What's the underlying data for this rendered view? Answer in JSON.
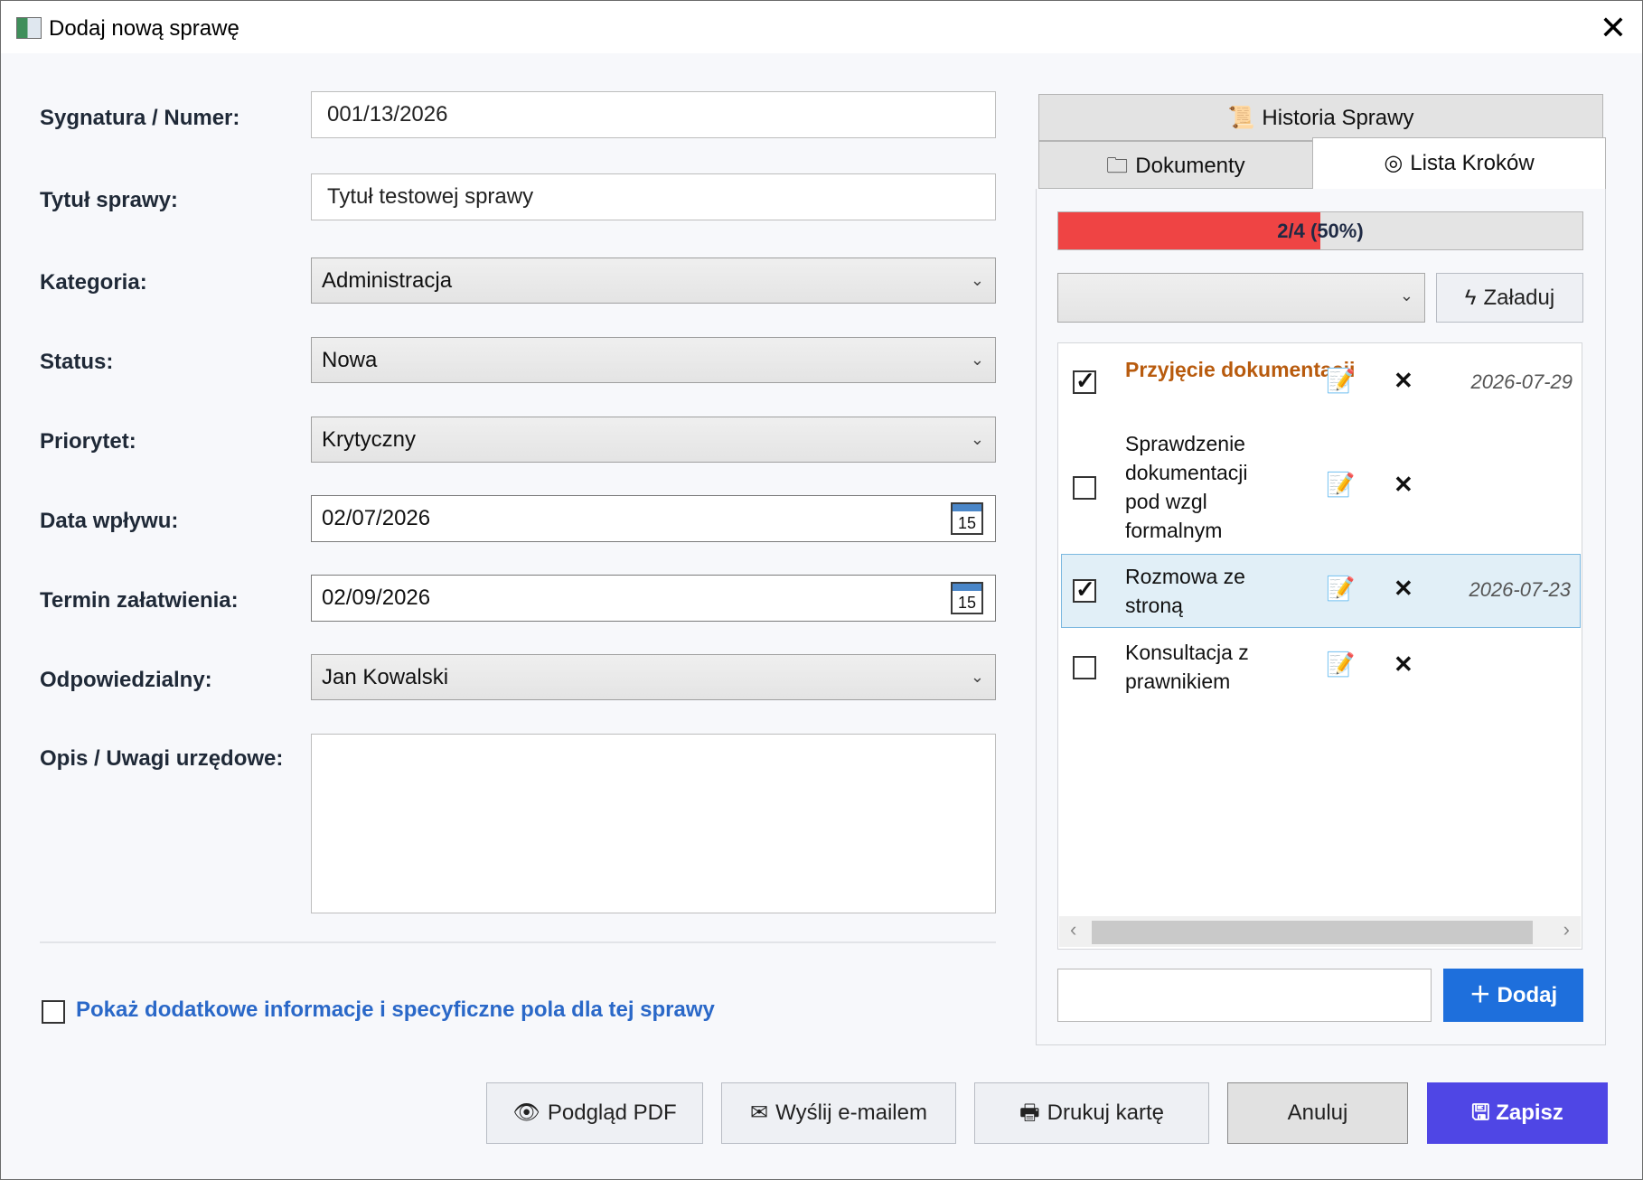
{
  "window": {
    "title": "Dodaj nową sprawę",
    "close_glyph": "✕"
  },
  "form": {
    "fields": [
      {
        "label": "Sygnatura / Numer:",
        "value": "001/13/2026"
      },
      {
        "label": "Tytuł sprawy:",
        "value": "Tytuł testowej sprawy"
      },
      {
        "label": "Kategoria:",
        "value": "Administracja"
      },
      {
        "label": "Status:",
        "value": "Nowa"
      },
      {
        "label": "Priorytet:",
        "value": "Krytyczny"
      },
      {
        "label": "Data wpływu:",
        "value": "02/07/2026",
        "calendar_day": "15"
      },
      {
        "label": "Termin załatwienia:",
        "value": "02/09/2026",
        "calendar_day": "15"
      },
      {
        "label": "Odpowiedzialny:",
        "value": "Jan Kowalski"
      },
      {
        "label": "Opis / Uwagi urzędowe:",
        "value": ""
      }
    ],
    "extra_checkbox": {
      "label": "Pokaż dodatkowe informacje i specyficzne pola dla tej sprawy",
      "checked": false
    }
  },
  "tabs": {
    "history": {
      "label": "Historia Sprawy",
      "icon": "scroll-icon"
    },
    "documents": {
      "label": "Dokumenty",
      "icon": "folder-icon"
    },
    "steps": {
      "label": "Lista Kroków",
      "icon": "target-icon",
      "active": true
    }
  },
  "steps_panel": {
    "progress": {
      "text": "2/4 (50%)",
      "fraction": 0.5,
      "color": "#ef4444"
    },
    "template_select": {
      "value": ""
    },
    "load_button": {
      "label": "Załaduj",
      "icon": "lightning-icon"
    },
    "steps": [
      {
        "name": "Przyjęcie dokumentacji",
        "checked": true,
        "highlight": true,
        "date": "2026-07-29",
        "selected": false
      },
      {
        "name": "Sprawdzenie dokumentacji pod wzgl formalnym",
        "checked": false,
        "highlight": false,
        "date": "",
        "selected": false
      },
      {
        "name": "Rozmowa ze stroną",
        "checked": true,
        "highlight": false,
        "date": "2026-07-23",
        "selected": true
      },
      {
        "name": "Konsultacja z prawnikiem",
        "checked": false,
        "highlight": false,
        "date": "",
        "selected": false
      }
    ],
    "new_step_input": {
      "value": ""
    },
    "add_button": {
      "label": "Dodaj",
      "icon": "plus-icon"
    }
  },
  "footer": {
    "pdf": {
      "label": "Podgląd PDF",
      "icon": "eye-icon"
    },
    "email": {
      "label": "Wyślij e-mailem",
      "icon": "envelope-icon"
    },
    "print": {
      "label": "Drukuj kartę",
      "icon": "printer-icon"
    },
    "cancel": {
      "label": "Anuluj"
    },
    "save": {
      "label": "Zapisz",
      "icon": "floppy-icon"
    }
  },
  "colors": {
    "accent_blue": "#1e6fdc",
    "save_purple": "#4f46e5",
    "link_blue": "#2a68c8",
    "highlight_orange": "#b85b0e"
  }
}
